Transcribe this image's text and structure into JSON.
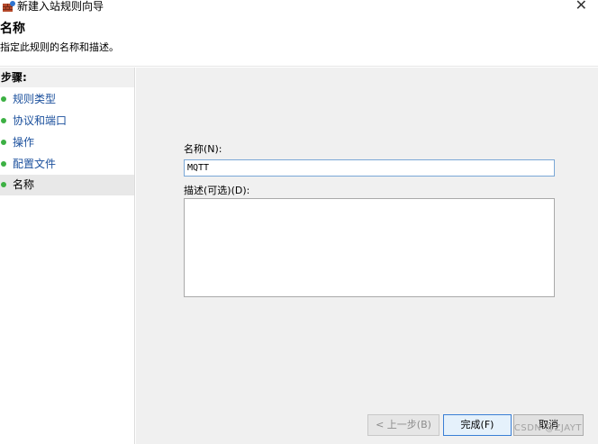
{
  "window": {
    "title": "新建入站规则向导",
    "close_glyph": "✕"
  },
  "header": {
    "heading": "名称",
    "description": "指定此规则的名称和描述。"
  },
  "sidebar": {
    "heading": "步骤:",
    "items": [
      {
        "label": "规则类型"
      },
      {
        "label": "协议和端口"
      },
      {
        "label": "操作"
      },
      {
        "label": "配置文件"
      },
      {
        "label": "名称"
      }
    ],
    "dot_color": "#3cb043"
  },
  "form": {
    "name_label": "名称(N):",
    "name_value": "MQTT",
    "desc_label": "描述(可选)(D):",
    "desc_value": ""
  },
  "buttons": {
    "back": "< 上一步(B)",
    "finish": "完成(F)",
    "cancel": "取消"
  },
  "watermark": "CSDN @ZJAYT",
  "colors": {
    "link_blue": "#1a4f9c",
    "panel_bg": "#f0f0f0",
    "focus_border": "#3a7fd5"
  }
}
